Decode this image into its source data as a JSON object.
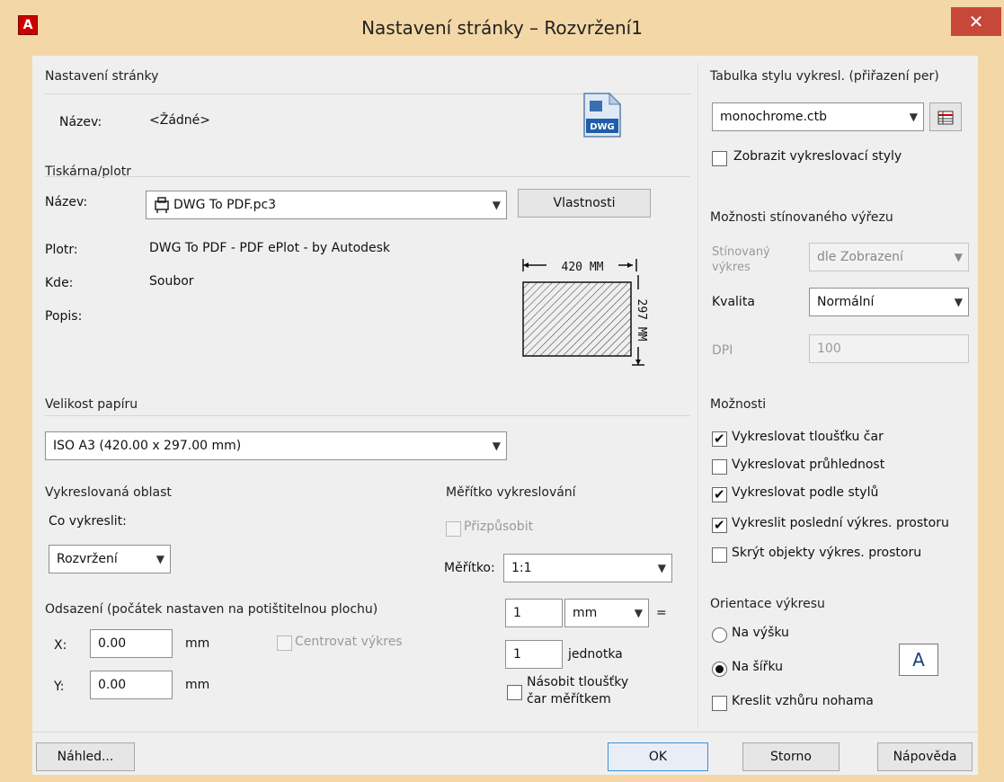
{
  "window": {
    "title": "Nastavení stránky – Rozvržení1",
    "close_glyph": "✕",
    "app_logo_letter": "A"
  },
  "page_setup": {
    "group_label": "Nastavení stránky",
    "name_label": "Název:",
    "name_value": "<Žádné>",
    "dwg_badge": "DWG"
  },
  "printer": {
    "group_label": "Tiskárna/plotr",
    "name_label": "Název:",
    "name_value": "DWG To PDF.pc3",
    "properties_button": "Vlastnosti",
    "plotter_label": "Plotr:",
    "plotter_value": "DWG To PDF - PDF ePlot - by Autodesk",
    "where_label": "Kde:",
    "where_value": "Soubor",
    "description_label": "Popis:",
    "preview_width_label": "420 MM",
    "preview_height_label": "297 MM"
  },
  "paper_size": {
    "group_label": "Velikost papíru",
    "value": "ISO A3 (420.00 x 297.00 mm)"
  },
  "plot_area": {
    "group_label": "Vykreslovaná oblast",
    "what_label": "Co vykreslit:",
    "what_value": "Rozvržení"
  },
  "offset": {
    "group_label": "Odsazení (počátek nastaven na potištitelnou plochu)",
    "x_label": "X:",
    "x_value": "0.00",
    "x_unit": "mm",
    "y_label": "Y:",
    "y_value": "0.00",
    "y_unit": "mm",
    "center_label": "Centrovat výkres",
    "center_checked": false
  },
  "scale": {
    "group_label": "Měřítko vykreslování",
    "fit_label": "Přizpůsobit",
    "fit_checked": false,
    "scale_label": "Měřítko:",
    "scale_value": "1:1",
    "value1": "1",
    "unit_value": "mm",
    "equals": "=",
    "value2": "1",
    "unit2_label": "jednotka",
    "lineweights_label_line1": "Násobit tloušťky",
    "lineweights_label_line2": "čar měřítkem",
    "lineweights_checked": false
  },
  "plot_style_table": {
    "group_label": "Tabulka stylu vykresl. (přiřazení per)",
    "value": "monochrome.ctb",
    "display_label": "Zobrazit vykreslovací styly",
    "display_checked": false
  },
  "shaded_viewport": {
    "group_label": "Možnosti stínovaného výřezu",
    "shade_label_line1": "Stínovaný",
    "shade_label_line2": "výkres",
    "shade_value": "dle Zobrazení",
    "quality_label": "Kvalita",
    "quality_value": "Normální",
    "dpi_label": "DPI",
    "dpi_value": "100"
  },
  "options": {
    "group_label": "Možnosti",
    "items": [
      {
        "label": "Vykreslovat tloušťku čar",
        "checked": true
      },
      {
        "label": "Vykreslovat průhlednost",
        "checked": false
      },
      {
        "label": "Vykreslovat podle stylů",
        "checked": true
      },
      {
        "label": "Vykreslit poslední výkres. prostoru",
        "checked": true
      },
      {
        "label": "Skrýt objekty výkres. prostoru",
        "checked": false
      }
    ]
  },
  "orientation": {
    "group_label": "Orientace výkresu",
    "portrait_label": "Na výšku",
    "landscape_label": "Na šířku",
    "landscape_selected": true,
    "upside_down_label": "Kreslit vzhůru nohama",
    "upside_down_checked": false,
    "icon_letter": "A"
  },
  "footer": {
    "preview_button": "Náhled...",
    "ok_button": "OK",
    "cancel_button": "Storno",
    "help_button": "Nápověda"
  },
  "colors": {
    "frame": "#f3d7a6",
    "close": "#c7483a",
    "dialog_bg": "#efefef",
    "default_button_border": "#3c8fd6"
  }
}
